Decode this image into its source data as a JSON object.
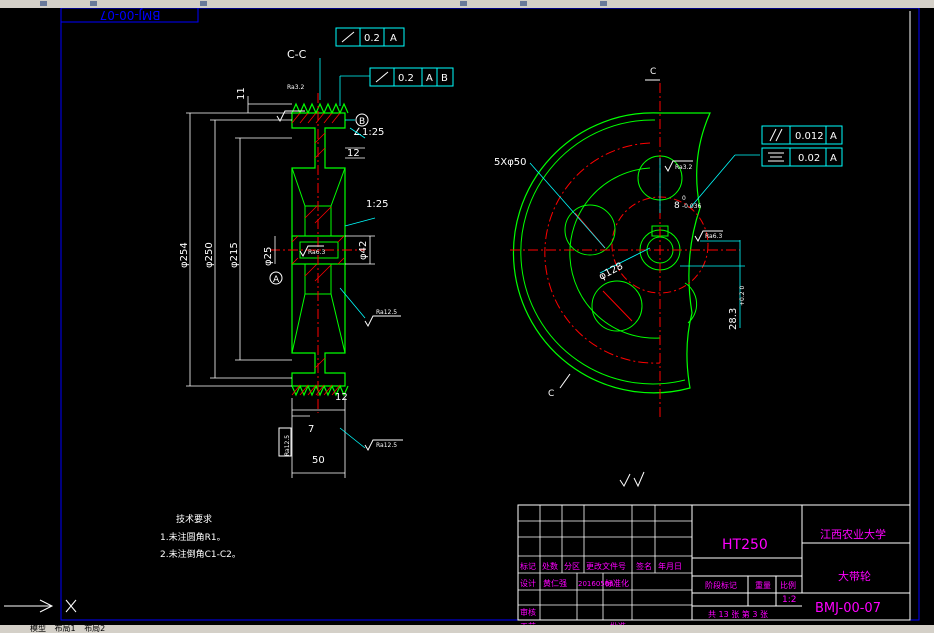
{
  "drawing": {
    "stamp_top_mirror": "BMJ-00-07",
    "section_label": "C-C",
    "tol_frame_1": {
      "value": "0.2",
      "datum": "A"
    },
    "tol_frame_2": {
      "value": "0.2",
      "datum1": "A",
      "datum2": "B"
    },
    "tol_frame_3": {
      "value": "0.012",
      "datum": "A"
    },
    "tol_frame_4": {
      "value": "0.02",
      "datum": "A"
    },
    "dims": {
      "d254": "φ254",
      "d250": "φ250",
      "d215": "φ215",
      "d25": "φ25",
      "d42": "φ42",
      "d11": "11",
      "d12a": "12",
      "d12b": "12",
      "d7": "7",
      "d50": "50",
      "taper1": "∠1:25",
      "taper2": "1:25",
      "holes": "5Xφ50",
      "pcd": "φ128",
      "key_width": "8",
      "key_tol_top": "0",
      "key_tol_bot": "-0.036",
      "key_depth": "28.3",
      "key_depth_tol": "+0.2 0"
    },
    "rough": {
      "r32a": "Ra3.2",
      "r32b": "Ra3.2",
      "r63a": "Ra6.3",
      "r63b": "Ra6.3",
      "r125a": "Ra12.5",
      "r125b": "Ra12.5",
      "r125c": "Ra12.5"
    },
    "datum_a": "A",
    "datum_b": "B",
    "cut_c_top": "C",
    "cut_c_bottom": "C"
  },
  "tech_requirements": {
    "title": "技术要求",
    "item1": "1.未注圆角R1。",
    "item2": "2.未注倒角C1-C2。"
  },
  "title_block": {
    "material": "HT250",
    "company": "江西农业大学",
    "part_name": "大带轮",
    "drawing_no": "BMJ-00-07",
    "row_headers": [
      "标记",
      "处数",
      "分区",
      "更改文件号",
      "签名",
      "年月日"
    ],
    "designer_label": "设计",
    "designer_name": "黄仁强",
    "design_date": "20160506",
    "standardize_label": "标准化",
    "stage_label": "阶段标记",
    "weight_label": "重量",
    "scale_label": "比例",
    "scale_value": "1:2",
    "check_label": "审核",
    "process_label": "工艺",
    "approve_label": "批准",
    "sheet_info": "共 13 张 第 3 张"
  },
  "layout_tabs": [
    "模型",
    "布局1",
    "布局2"
  ],
  "colors": {
    "green": "#00ff00",
    "red": "#ff0000",
    "cyan": "#00ffff",
    "white": "#ffffff",
    "blue": "#0000ff",
    "magenta": "#ff00ff"
  }
}
